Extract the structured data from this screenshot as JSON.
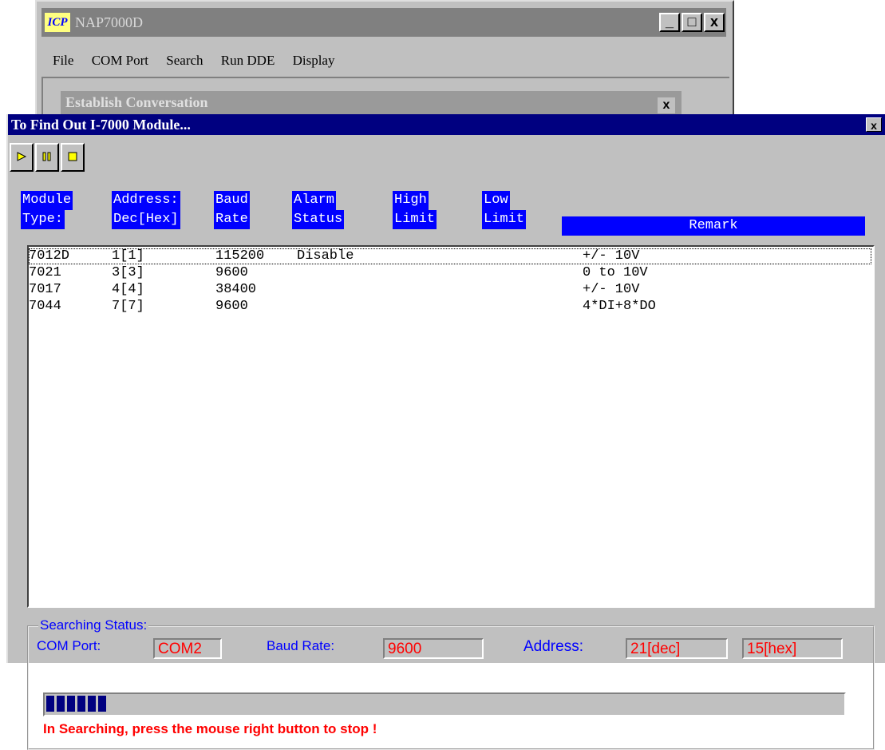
{
  "background_window": {
    "icon_text": "ICP",
    "title": "NAP7000D",
    "buttons": [
      "_",
      "□",
      "x"
    ],
    "menu": [
      "File",
      "COM Port",
      "Search",
      "Run DDE",
      "Display"
    ],
    "child_title": "Establish Conversation",
    "child_close": "x"
  },
  "dialog": {
    "title": "To Find Out I-7000 Module...",
    "close": "x",
    "toolbar": [
      {
        "name": "start",
        "icon": "play-icon"
      },
      {
        "name": "pause",
        "icon": "pause-icon"
      },
      {
        "name": "stop",
        "icon": "stop-icon"
      }
    ],
    "columns": [
      {
        "line1": "Module",
        "line2": "Type:"
      },
      {
        "line1": "Address:",
        "line2": "Dec[Hex]"
      },
      {
        "line1": "Baud",
        "line2": "Rate"
      },
      {
        "line1": "Alarm",
        "line2": "Status"
      },
      {
        "line1": "High",
        "line2": "Limit"
      },
      {
        "line1": "Low",
        "line2": "Limit"
      },
      {
        "line1": "",
        "line2": "Remark"
      }
    ],
    "rows": [
      {
        "type": "7012D",
        "address": "1[1]",
        "baud": "115200",
        "alarm": "Disable",
        "high": "",
        "low": "",
        "remark": "+/- 10V"
      },
      {
        "type": "7021",
        "address": "3[3]",
        "baud": "9600",
        "alarm": "",
        "high": "",
        "low": "",
        "remark": "0 to 10V"
      },
      {
        "type": "7017",
        "address": "4[4]",
        "baud": "38400",
        "alarm": "",
        "high": "",
        "low": "",
        "remark": "+/- 10V"
      },
      {
        "type": "7044",
        "address": "7[7]",
        "baud": "9600",
        "alarm": "",
        "high": "",
        "low": "",
        "remark": "4*DI+8*DO"
      }
    ],
    "status": {
      "group_label": "Searching Status:",
      "com_port_label": "COM Port:",
      "com_port_value": "COM2",
      "baud_label": "Baud Rate:",
      "baud_value": "9600",
      "address_label": "Address:",
      "address_dec": "21[dec]",
      "address_hex": "15[hex]",
      "progress_blocks": 6,
      "message": "In Searching, press the mouse right button to stop !"
    }
  }
}
